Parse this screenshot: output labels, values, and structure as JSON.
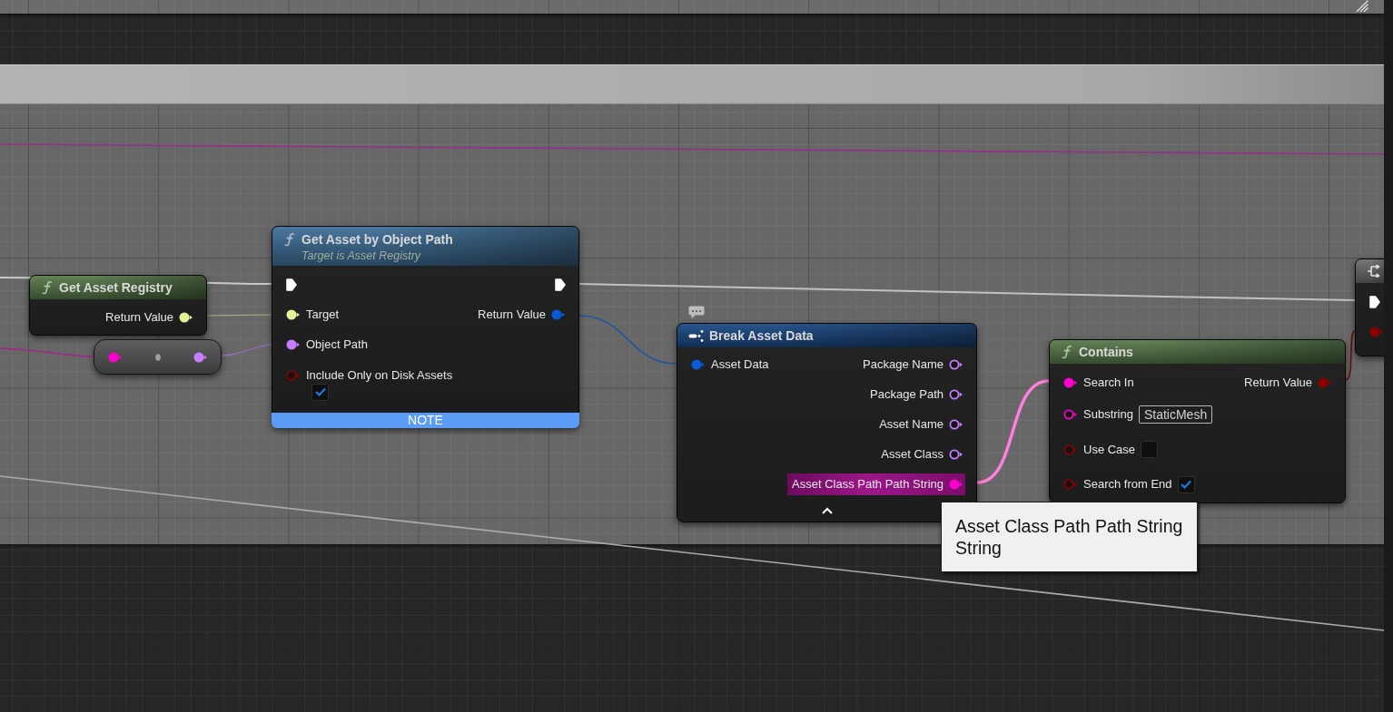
{
  "graph": {
    "nodes": [
      {
        "kind": "function",
        "color": "#587a4b",
        "title": "Get Asset Registry",
        "outputs": [
          {
            "kind": "data",
            "label": "Return Value",
            "color": "#e5f29a",
            "connected": true
          }
        ]
      },
      {
        "kind": "conversion",
        "inputs": [
          {
            "kind": "data",
            "color": "#ff00cc",
            "connected": true
          }
        ],
        "outputs": [
          {
            "kind": "data",
            "color": "#c77dff",
            "connected": true
          }
        ]
      },
      {
        "kind": "function",
        "color": "#3f6f98",
        "title": "Get Asset by Object Path",
        "subtitle": "Target is Asset Registry",
        "footer": "NOTE",
        "inputs": [
          {
            "kind": "exec",
            "connected": true
          },
          {
            "kind": "data",
            "label": "Target",
            "color": "#e5f29a",
            "connected": true
          },
          {
            "kind": "data",
            "label": "Object Path",
            "color": "#c77dff",
            "connected": true
          },
          {
            "kind": "data",
            "label": "Include Only on Disk Assets",
            "color": "#8c0000",
            "connected": false,
            "checked": true
          }
        ],
        "outputs": [
          {
            "kind": "exec",
            "connected": true
          },
          {
            "kind": "data",
            "label": "Return Value",
            "color": "#0a5ad8",
            "connected": true
          }
        ]
      },
      {
        "kind": "break",
        "color": "#1b4a86",
        "title": "Break Asset Data",
        "comment_bubble": true,
        "advanced_expanded": true,
        "inputs": [
          {
            "kind": "data",
            "label": "Asset Data",
            "color": "#0a5ad8",
            "connected": true
          }
        ],
        "outputs": [
          {
            "kind": "data",
            "label": "Package Name",
            "color": "#c77dff",
            "connected": false,
            "highlighted": false
          },
          {
            "kind": "data",
            "label": "Package Path",
            "color": "#c77dff",
            "connected": false,
            "highlighted": false
          },
          {
            "kind": "data",
            "label": "Asset Name",
            "color": "#c77dff",
            "connected": false,
            "highlighted": false
          },
          {
            "kind": "data",
            "label": "Asset Class",
            "color": "#c77dff",
            "connected": false,
            "highlighted": false
          },
          {
            "kind": "data",
            "label": "Asset Class Path Path String",
            "color": "#ff00cc",
            "connected": true,
            "highlighted": true
          }
        ]
      },
      {
        "kind": "function",
        "color": "#587a4b",
        "title": "Contains",
        "inputs": [
          {
            "kind": "data",
            "label": "Search In",
            "color": "#ff00cc",
            "connected": true
          },
          {
            "kind": "data",
            "label": "Substring",
            "color": "#ff00cc",
            "connected": false,
            "value": "StaticMesh"
          },
          {
            "kind": "data",
            "label": "Use Case",
            "color": "#8c0000",
            "connected": false,
            "checked": false
          },
          {
            "kind": "data",
            "label": "Search from End",
            "color": "#8c0000",
            "connected": false,
            "checked": true
          }
        ],
        "outputs": [
          {
            "kind": "data",
            "label": "Return Value",
            "color": "#8c0000",
            "connected": true
          }
        ]
      },
      {
        "kind": "icon",
        "color": "#6e6e6e",
        "inputs": [
          {
            "kind": "exec",
            "connected": true
          },
          {
            "kind": "data",
            "color": "#8c0000",
            "connected": true
          }
        ]
      }
    ],
    "tooltip": {
      "pin_name": "Asset Class Path Path String",
      "pin_type": "String"
    }
  }
}
